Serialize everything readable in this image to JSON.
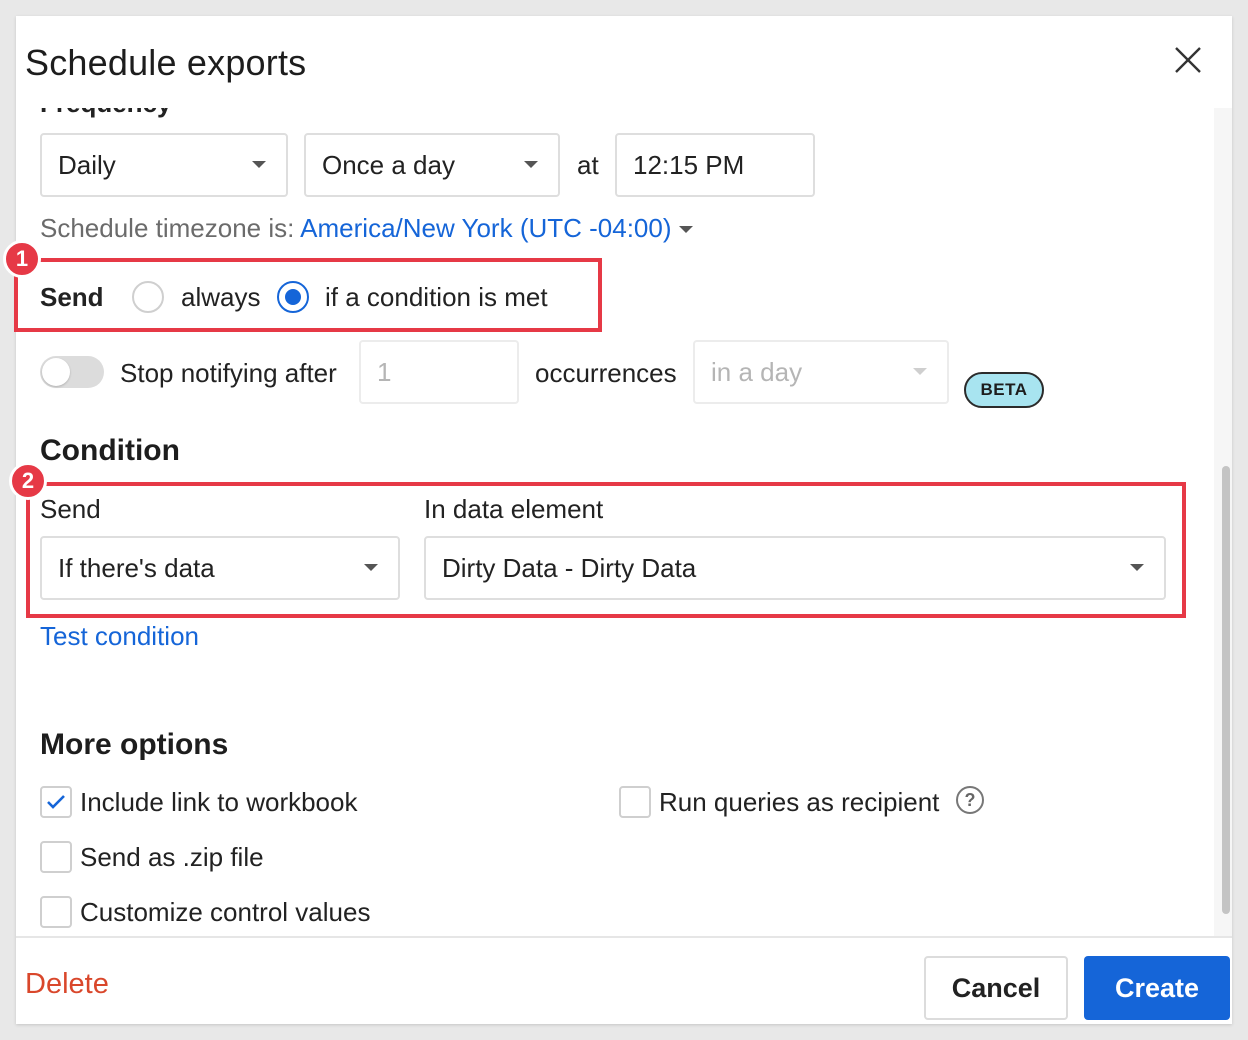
{
  "dialog": {
    "title": "Schedule exports",
    "cut_heading": "Frequency"
  },
  "frequency": {
    "period": "Daily",
    "times": "Once a day",
    "at_label": "at",
    "time": "12:15 PM",
    "timezone_label": "Schedule timezone is:",
    "timezone_value": "America/New York (UTC -04:00)"
  },
  "send": {
    "label": "Send",
    "option_always": "always",
    "option_condition": "if a condition is met",
    "selected": "if a condition is met"
  },
  "stop_notifying": {
    "label": "Stop notifying after",
    "count": "1",
    "occurrences_label": "occurrences",
    "window": "in a day",
    "badge": "BETA",
    "enabled": false
  },
  "condition": {
    "heading": "Condition",
    "send_label": "Send",
    "send_value": "If there's data",
    "element_label": "In data element",
    "element_value": "Dirty Data - Dirty Data",
    "test_link": "Test condition"
  },
  "more_options": {
    "heading": "More options",
    "include_link": "Include link to workbook",
    "zip": "Send as .zip file",
    "customize": "Customize control values",
    "run_as_recipient": "Run queries as recipient",
    "help_glyph": "?"
  },
  "annotations": {
    "badge_1": "1",
    "badge_2": "2"
  },
  "footer": {
    "delete": "Delete",
    "cancel": "Cancel",
    "create": "Create"
  },
  "colors": {
    "accent": "#1565d8",
    "highlight": "#e63946",
    "delete": "#d9472b",
    "beta_bg": "#a8e4f0"
  },
  "icons": [
    "close-icon",
    "chevron-down-icon",
    "checkmark-icon",
    "help-icon"
  ]
}
